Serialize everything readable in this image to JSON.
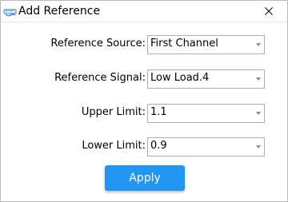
{
  "window": {
    "title": "Add Reference",
    "app_icon": "ruler-cable-icon",
    "close_icon": "close-icon"
  },
  "form": {
    "fields": [
      {
        "label": "Reference Source:",
        "value": "First Channel"
      },
      {
        "label": "Reference Signal:",
        "value": "Low Load.4"
      },
      {
        "label": "Upper Limit:",
        "value": "1.1"
      },
      {
        "label": "Lower Limit:",
        "value": "0.9"
      }
    ]
  },
  "actions": {
    "apply_label": "Apply"
  },
  "colors": {
    "accent": "#2196f3",
    "border": "#abadb3"
  }
}
